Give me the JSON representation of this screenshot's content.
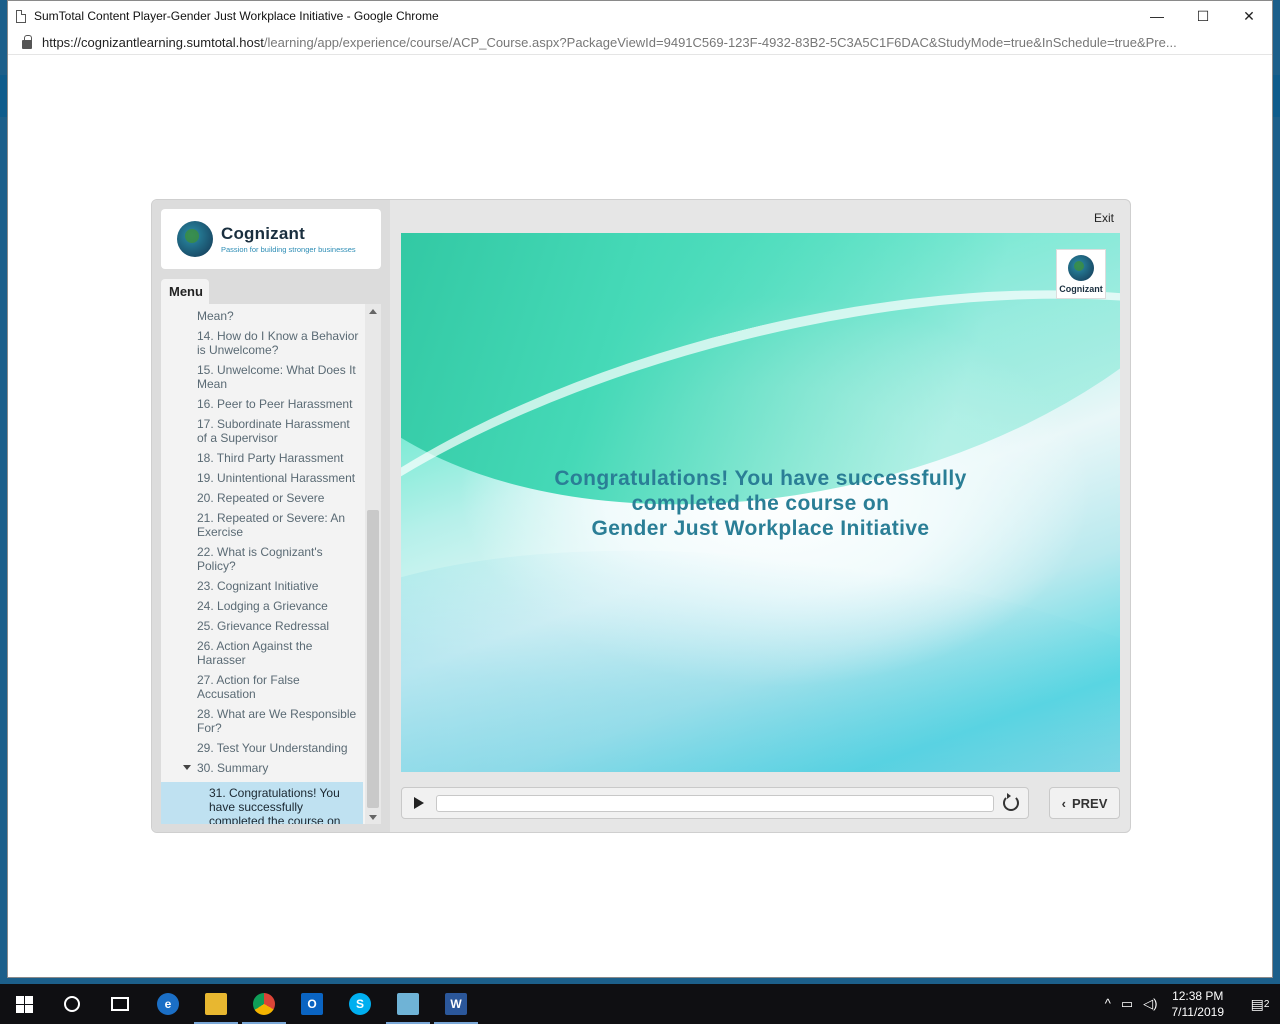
{
  "window": {
    "title": "SumTotal Content Player-Gender Just Workplace Initiative - Google Chrome",
    "url_host": "https://cognizantlearning.sumtotal.host",
    "url_path": "/learning/app/experience/course/ACP_Course.aspx?PackageViewId=9491C569-123F-4932-83B2-5C3A5C1F6DAC&StudyMode=true&InSchedule=true&Pre...",
    "minimize_glyph": "—",
    "maximize_glyph": "☐",
    "close_glyph": "✕"
  },
  "player": {
    "logo_name": "Cognizant",
    "logo_tagline": "Passion for building stronger businesses",
    "menu_label": "Menu",
    "exit_label": "Exit",
    "menu_items": [
      "Mean?",
      "14. How do I Know a Behavior is Unwelcome?",
      "15. Unwelcome: What Does It Mean",
      "16. Peer to Peer Harassment",
      "17. Subordinate Harassment of a Supervisor",
      "18. Third Party Harassment",
      "19. Unintentional Harassment",
      "20. Repeated or Severe",
      "21. Repeated or Severe: An Exercise",
      "22. What is Cognizant's Policy?",
      "23. Cognizant Initiative",
      "24. Lodging a Grievance",
      "25. Grievance Redressal",
      "26. Action Against the Harasser",
      "27. Action for False Accusation",
      "28. What are We Responsible For?",
      "29. Test Your Understanding"
    ],
    "expanded_item": "30. Summary",
    "active_item": "31. Congratulations! You have successfully completed the course on",
    "slide": {
      "logo_text": "Cognizant",
      "line1": "Congratulations! You have successfully",
      "line2": "completed the course on",
      "line3": "Gender Just Workplace Initiative"
    },
    "prev_label": "PREV",
    "progress_fraction": 0
  },
  "taskbar": {
    "time": "12:38 PM",
    "date": "7/11/2019",
    "notification_count": "2",
    "apps": [
      "start",
      "cortana",
      "task-view",
      "edge",
      "file-explorer",
      "chrome",
      "outlook",
      "skype",
      "notepad",
      "word"
    ]
  },
  "colors": {
    "slide_title": "#2a7e96",
    "active_menu_bg": "#bfe1f1",
    "desktop": "#1c5f8a"
  }
}
